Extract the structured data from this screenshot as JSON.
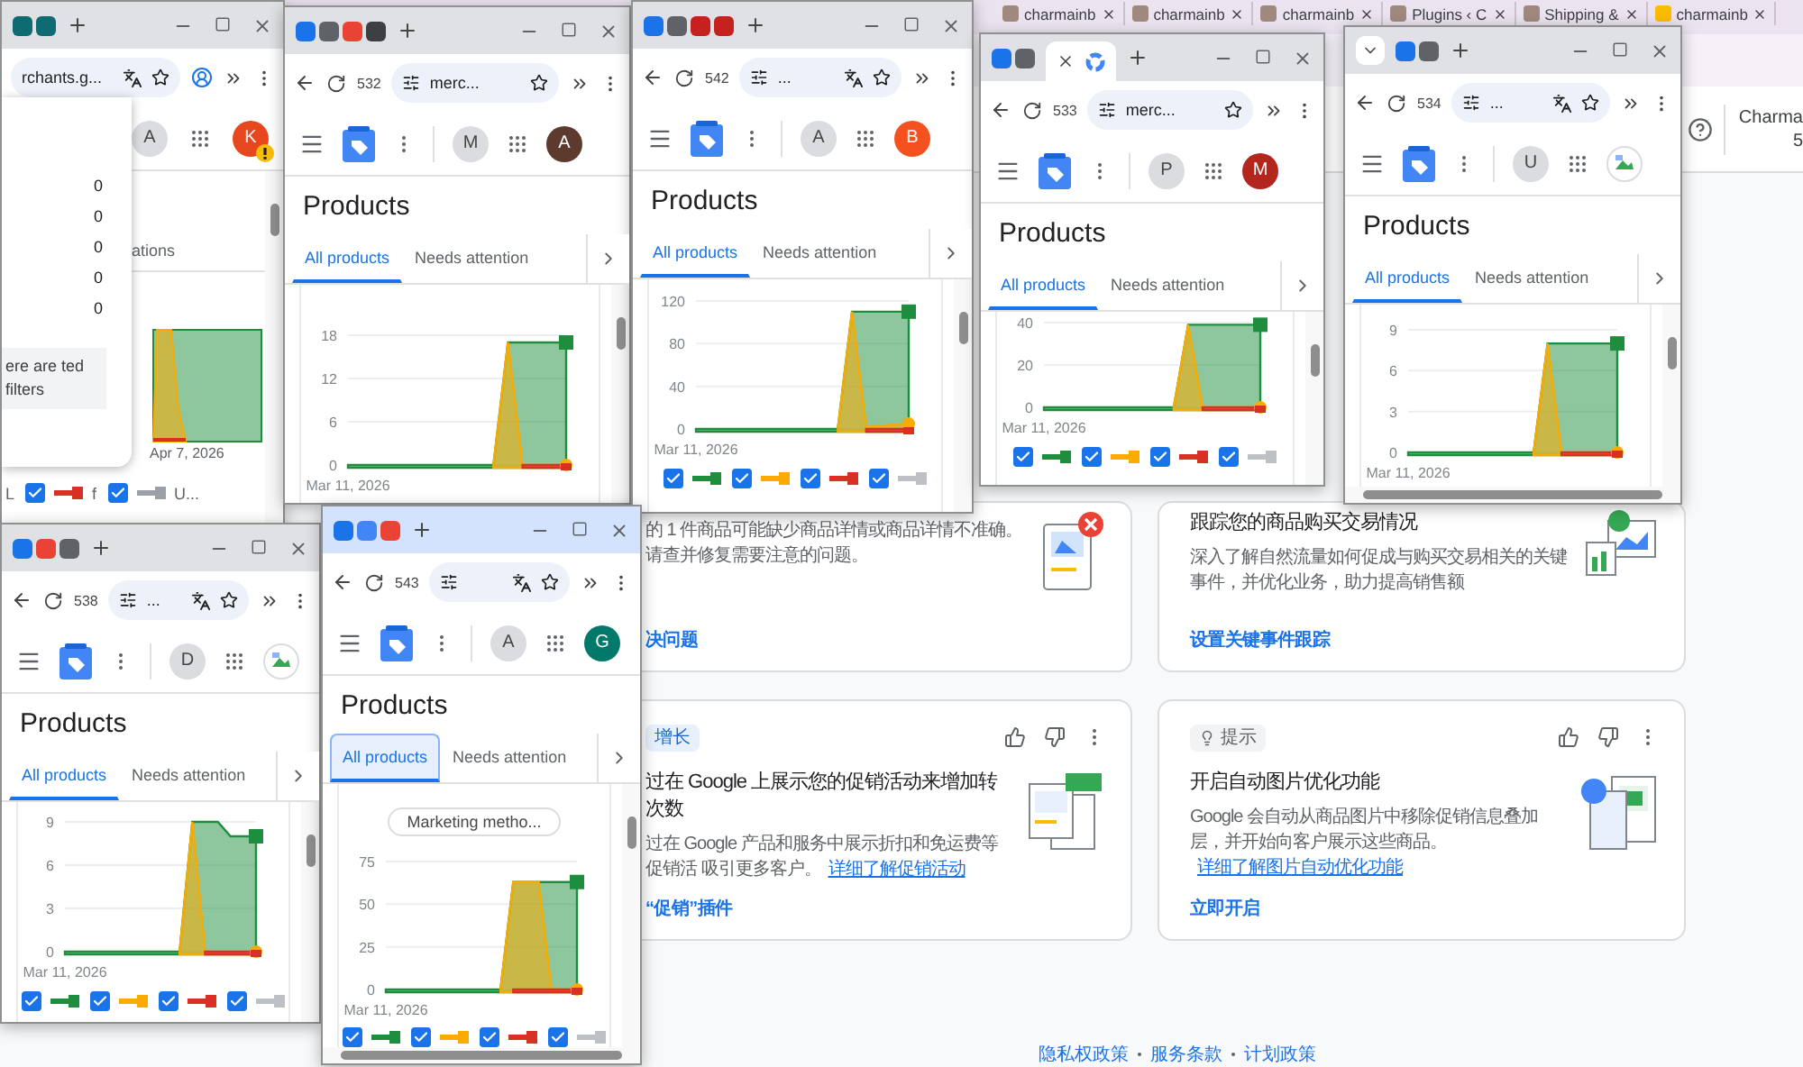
{
  "background_browser": {
    "tabs": [
      {
        "label": "charmainb",
        "selected": false
      },
      {
        "label": "charmainb",
        "selected": false
      },
      {
        "label": "charmainb",
        "selected": false
      },
      {
        "label": "Plugins ‹ C",
        "selected": false
      },
      {
        "label": "Shipping &",
        "selected": false
      },
      {
        "label": "charmainb",
        "selected": false
      }
    ],
    "header": {
      "account_name": "Charma",
      "account_id": "5"
    },
    "cards": [
      {
        "body": "的 1 件商品可能缺少商品详情或商品详情不准确。请查并修复需要注意的问题。",
        "action": "决问题"
      },
      {
        "title": "跟踪您的商品购买交易情况",
        "body": "深入了解自然流量如何促成与购买交易相关的关键事件，并优化业务，助力提高销售额",
        "action": "设置关键事件跟踪"
      },
      {
        "tag": {
          "kind": "growth",
          "label": "增长"
        },
        "feedback": true,
        "title": "过在 Google 上展示您的促销活动来增加转次数",
        "body": "过在 Google 产品和服务中展示折扣和免运费等促销活 吸引更多客户。",
        "link": "详细了解促销活动",
        "action": "“促销”插件"
      },
      {
        "tag": {
          "kind": "tip",
          "label": "提示"
        },
        "feedback": true,
        "title": "开启自动图片优化功能",
        "body": "Google 会自动从商品图片中移除促销信息叠加层，并开始向客户展示这些商品。",
        "link": "详细了解图片自动优化功能",
        "action": "立即开启"
      }
    ],
    "footer_links": [
      "隐私权政策",
      "服务条款",
      "计划政策"
    ]
  },
  "windows": [
    {
      "kind": "filters_panel",
      "active": false,
      "address": "rchants.g...",
      "account_initial": "A",
      "avatar": {
        "kind": "letter",
        "letter": "K",
        "color": "#e8461e",
        "warning": true
      },
      "tab_fragment": "ations",
      "panel": {
        "counts": [
          "0",
          "0",
          "0",
          "0",
          "0"
        ],
        "note": "ere are ted filters"
      },
      "chart_label": "Apr 7, 2026",
      "legend": [
        {
          "label": "L"
        },
        {
          "checked": true,
          "color": "#d93025",
          "label": "f"
        },
        {
          "checked": true,
          "color": "#9aa0a6",
          "label": "U..."
        }
      ]
    },
    {
      "kind": "products",
      "active": false,
      "tab_count": "532",
      "address": "merc...",
      "account_initial": "M",
      "avatar": {
        "kind": "letter",
        "letter": "A",
        "color": "#5d3a2e"
      },
      "page_title": "Products",
      "tabs": [
        {
          "label": "All products",
          "selected": true
        },
        {
          "label": "Needs attention",
          "selected": false
        }
      ],
      "chart_data": {
        "type": "area",
        "ylim": [
          0,
          18
        ],
        "yticks": [
          0,
          6,
          12,
          18
        ],
        "categories": [
          "Mar 11, 2026",
          null,
          null,
          null,
          null,
          null,
          null,
          null,
          null,
          null,
          null,
          null,
          null,
          null,
          null,
          null
        ],
        "series": [
          {
            "color": "#1e8e3e",
            "values": [
              0,
              0,
              0,
              0,
              0,
              0,
              0,
              0,
              0,
              0,
              0,
              17,
              17,
              17,
              17,
              17
            ]
          },
          {
            "color": "#f9ab00",
            "values": [
              null,
              null,
              null,
              null,
              null,
              null,
              null,
              null,
              null,
              null,
              0,
              17,
              0,
              0,
              0,
              0
            ]
          },
          {
            "color": "#d93025",
            "values": [
              null,
              null,
              null,
              null,
              null,
              null,
              null,
              null,
              null,
              null,
              null,
              null,
              0,
              0,
              0,
              0
            ]
          }
        ]
      }
    },
    {
      "kind": "products",
      "active": false,
      "tab_count": "542",
      "address": "...",
      "account_initial": "A",
      "avatar": {
        "kind": "letter",
        "letter": "B",
        "color": "#f4511e"
      },
      "page_title": "Products",
      "tabs": [
        {
          "label": "All products",
          "selected": true
        },
        {
          "label": "Needs attention",
          "selected": false
        }
      ],
      "chart_data": {
        "type": "area",
        "ylim": [
          0,
          120
        ],
        "yticks": [
          0,
          40,
          80,
          120
        ],
        "categories": [
          "Mar 11, 2026",
          null,
          null,
          null,
          null,
          null,
          null,
          null,
          null,
          null,
          null,
          null,
          null,
          null,
          null,
          null
        ],
        "series": [
          {
            "color": "#1e8e3e",
            "values": [
              0,
              0,
              0,
              0,
              0,
              0,
              0,
              0,
              0,
              0,
              0,
              110,
              110,
              110,
              110,
              110
            ]
          },
          {
            "color": "#f9ab00",
            "values": [
              null,
              null,
              null,
              null,
              null,
              null,
              null,
              null,
              null,
              null,
              0,
              110,
              2,
              3,
              4,
              5
            ]
          },
          {
            "color": "#d93025",
            "values": [
              null,
              null,
              null,
              null,
              null,
              null,
              null,
              null,
              null,
              null,
              null,
              null,
              0,
              0,
              0,
              0
            ]
          }
        ]
      },
      "legend": [
        {
          "checked": true,
          "color": "#1e8e3e"
        },
        {
          "checked": true,
          "color": "#f9ab00"
        },
        {
          "checked": true,
          "color": "#d93025"
        },
        {
          "checked": true,
          "color": "#bdc1c6"
        }
      ]
    },
    {
      "kind": "products",
      "active": false,
      "tab_count": "533",
      "address": "merc...",
      "account_initial": "P",
      "avatar": {
        "kind": "letter",
        "letter": "M",
        "color": "#b3261e"
      },
      "page_title": "Products",
      "tabs": [
        {
          "label": "All products",
          "selected": true
        },
        {
          "label": "Needs attention",
          "selected": false
        }
      ],
      "chart_data": {
        "type": "area",
        "ylim": [
          0,
          40
        ],
        "yticks": [
          0,
          20,
          40
        ],
        "categories": [
          "Mar 11, 2026",
          null,
          null,
          null,
          null,
          null,
          null,
          null,
          null,
          null,
          null,
          null,
          null,
          null,
          null,
          null
        ],
        "series": [
          {
            "color": "#1e8e3e",
            "values": [
              0,
              0,
              0,
              0,
              0,
              0,
              0,
              0,
              0,
              0,
              39,
              39,
              39,
              39,
              39,
              39
            ]
          },
          {
            "color": "#f9ab00",
            "values": [
              null,
              null,
              null,
              null,
              null,
              null,
              null,
              null,
              null,
              0,
              39,
              0,
              0,
              0,
              0,
              0
            ]
          },
          {
            "color": "#d93025",
            "values": [
              null,
              null,
              null,
              null,
              null,
              null,
              null,
              null,
              null,
              null,
              null,
              0,
              0,
              0,
              0,
              0
            ]
          }
        ]
      },
      "legend": [
        {
          "checked": true,
          "color": "#1e8e3e"
        },
        {
          "checked": true,
          "color": "#f9ab00"
        },
        {
          "checked": true,
          "color": "#d93025"
        },
        {
          "checked": true,
          "color": "#bdc1c6"
        }
      ]
    },
    {
      "kind": "products",
      "active": false,
      "tab_count": "534",
      "address": "...",
      "account_initial": "U",
      "avatar": {
        "kind": "image"
      },
      "page_title": "Products",
      "tabs": [
        {
          "label": "All products",
          "selected": true
        },
        {
          "label": "Needs attention",
          "selected": false
        }
      ],
      "chart_data": {
        "type": "area",
        "ylim": [
          0,
          9
        ],
        "yticks": [
          0,
          3,
          6,
          9
        ],
        "categories": [
          "Mar 11, 2026",
          null,
          null,
          null,
          null,
          null,
          null,
          null,
          null,
          null,
          null,
          null,
          null,
          null,
          null,
          null
        ],
        "series": [
          {
            "color": "#1e8e3e",
            "values": [
              0,
              0,
              0,
              0,
              0,
              0,
              0,
              0,
              0,
              0,
              8,
              8,
              8,
              8,
              8,
              8
            ]
          },
          {
            "color": "#f9ab00",
            "values": [
              null,
              null,
              null,
              null,
              null,
              null,
              null,
              null,
              null,
              0,
              8,
              0,
              0,
              0,
              0,
              0
            ]
          },
          {
            "color": "#d93025",
            "values": [
              null,
              null,
              null,
              null,
              null,
              null,
              null,
              null,
              null,
              null,
              null,
              0,
              0,
              0,
              0,
              0
            ]
          }
        ]
      }
    },
    {
      "kind": "products",
      "active": false,
      "tab_count": "538",
      "address": "...",
      "account_initial": "D",
      "avatar": {
        "kind": "image"
      },
      "page_title": "Products",
      "tabs": [
        {
          "label": "All products",
          "selected": true
        },
        {
          "label": "Needs attention",
          "selected": false
        }
      ],
      "chart_data": {
        "type": "area",
        "ylim": [
          0,
          9
        ],
        "yticks": [
          0,
          3,
          6,
          9
        ],
        "categories": [
          "Mar 11, 2026",
          null,
          null,
          null,
          null,
          null,
          null,
          null,
          null,
          null,
          null,
          null,
          null,
          null,
          null,
          null
        ],
        "series": [
          {
            "color": "#1e8e3e",
            "values": [
              0,
              0,
              0,
              0,
              0,
              0,
              0,
              0,
              0,
              0,
              9,
              9,
              9,
              8,
              8,
              8
            ]
          },
          {
            "color": "#f9ab00",
            "values": [
              null,
              null,
              null,
              null,
              null,
              null,
              null,
              null,
              null,
              0,
              9,
              0,
              0,
              0,
              0,
              0
            ]
          },
          {
            "color": "#d93025",
            "values": [
              null,
              null,
              null,
              null,
              null,
              null,
              null,
              null,
              null,
              null,
              null,
              0,
              0,
              0,
              0,
              0
            ]
          }
        ]
      },
      "legend": [
        {
          "checked": true,
          "color": "#1e8e3e"
        },
        {
          "checked": true,
          "color": "#f9ab00"
        },
        {
          "checked": true,
          "color": "#d93025"
        },
        {
          "checked": true,
          "color": "#bdc1c6"
        }
      ]
    },
    {
      "kind": "products",
      "active": true,
      "tab_count": "543",
      "account_initial": "A",
      "avatar": {
        "kind": "letter",
        "letter": "G",
        "color": "#00796b"
      },
      "page_title": "Products",
      "tabs": [
        {
          "label": "All products",
          "selected": true,
          "focused": true
        },
        {
          "label": "Needs attention",
          "selected": false,
          "focused": false
        }
      ],
      "chip": "Marketing metho...",
      "chart_data": {
        "type": "area",
        "ylim": [
          0,
          75
        ],
        "yticks": [
          0,
          25,
          50,
          75
        ],
        "categories": [
          "Mar 11, 2026",
          null,
          null,
          null,
          null,
          null,
          null,
          null,
          null,
          null,
          null,
          null,
          null,
          null,
          null,
          null
        ],
        "series": [
          {
            "color": "#1e8e3e",
            "values": [
              0,
              0,
              0,
              0,
              0,
              0,
              0,
              0,
              0,
              0,
              63,
              63,
              63,
              63,
              63,
              63
            ]
          },
          {
            "color": "#f9ab00",
            "values": [
              null,
              null,
              null,
              null,
              null,
              null,
              null,
              null,
              null,
              0,
              63,
              63,
              63,
              0,
              0,
              0
            ]
          },
          {
            "color": "#d93025",
            "values": [
              null,
              null,
              null,
              null,
              null,
              null,
              null,
              null,
              null,
              null,
              0,
              0,
              0,
              0,
              0,
              0
            ]
          }
        ]
      },
      "legend": [
        {
          "checked": true,
          "color": "#1e8e3e"
        },
        {
          "checked": true,
          "color": "#f9ab00"
        },
        {
          "checked": true,
          "color": "#d93025"
        },
        {
          "checked": true,
          "color": "#bdc1c6"
        }
      ]
    }
  ]
}
